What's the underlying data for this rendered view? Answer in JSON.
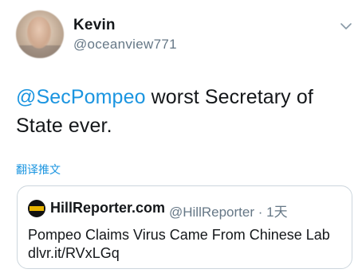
{
  "tweet": {
    "author_name": "Kevin",
    "author_handle": "@oceanview771",
    "mention": "@SecPompeo",
    "text": " worst Secretary of State ever.",
    "translate_label": "翻译推文"
  },
  "quoted": {
    "author_name": "HillReporter.com",
    "author_handle_time": "@HillReporter · 1天",
    "line1": "Pompeo Claims Virus Came From Chinese Lab",
    "line2": "dlvr.it/RVxLGq"
  },
  "colors": {
    "link": "#1b95e0",
    "secondary": "#657786",
    "text": "#14171a",
    "border": "#ccd6dd"
  },
  "icons": {
    "menu": "chevron-down-icon"
  }
}
